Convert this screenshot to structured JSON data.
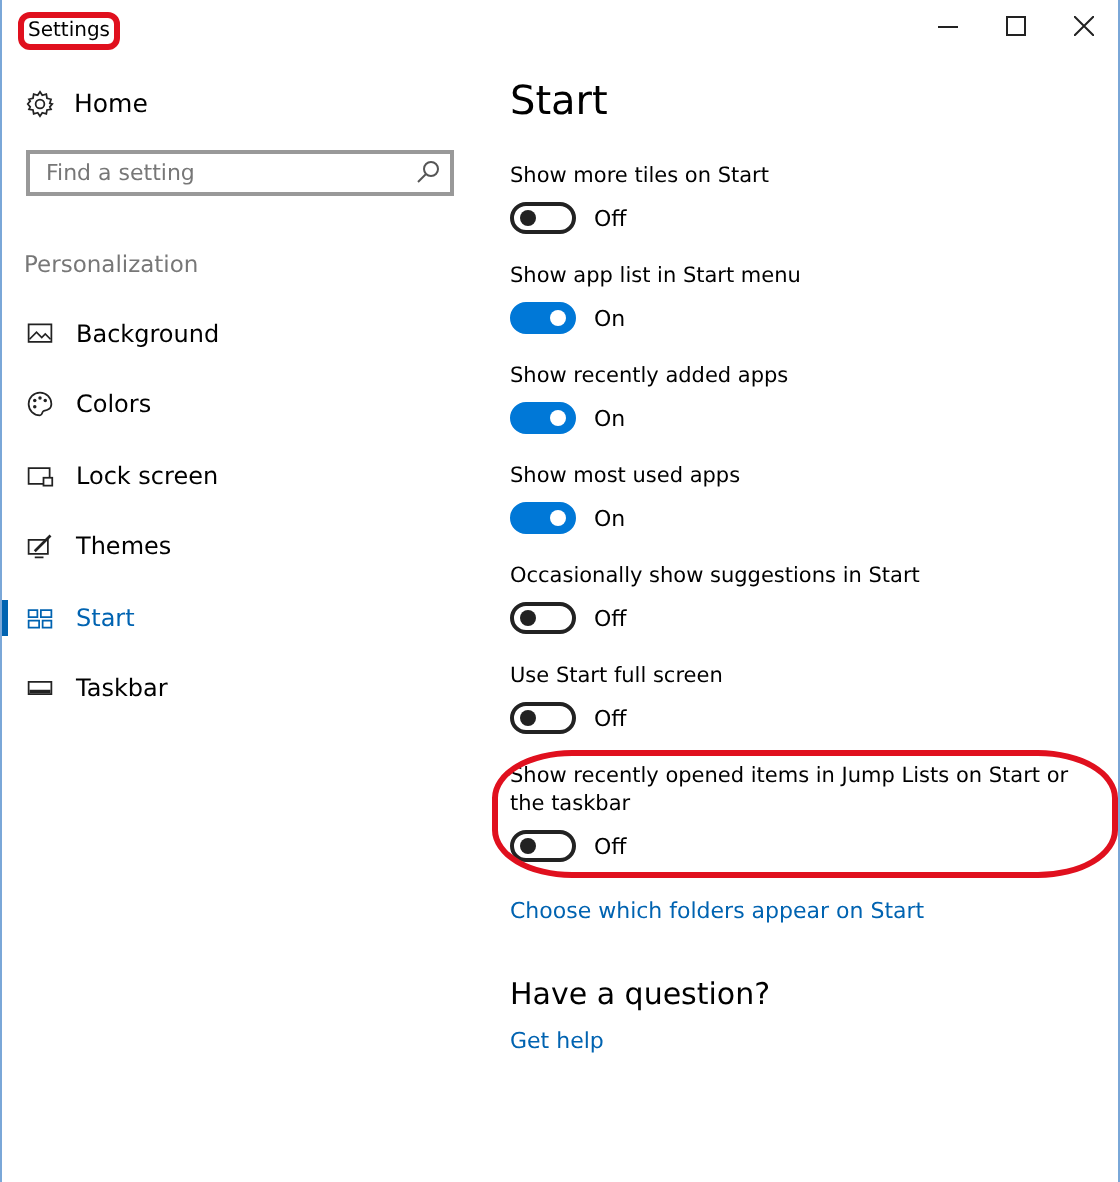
{
  "window": {
    "title": "Settings",
    "title_highlighted": true
  },
  "sidebar": {
    "home": "Home",
    "search": {
      "placeholder": "Find a setting"
    },
    "section": "Personalization",
    "items": [
      {
        "label": "Background",
        "selected": false
      },
      {
        "label": "Colors",
        "selected": false
      },
      {
        "label": "Lock screen",
        "selected": false
      },
      {
        "label": "Themes",
        "selected": false
      },
      {
        "label": "Start",
        "selected": true
      },
      {
        "label": "Taskbar",
        "selected": false
      }
    ]
  },
  "page": {
    "title": "Start",
    "settings": [
      {
        "label": "Show more tiles on Start",
        "on": false,
        "state": "Off",
        "highlighted": false
      },
      {
        "label": "Show app list in Start menu",
        "on": true,
        "state": "On",
        "highlighted": false
      },
      {
        "label": "Show recently added apps",
        "on": true,
        "state": "On",
        "highlighted": false
      },
      {
        "label": "Show most used apps",
        "on": true,
        "state": "On",
        "highlighted": false
      },
      {
        "label": "Occasionally show suggestions in Start",
        "on": false,
        "state": "Off",
        "highlighted": false
      },
      {
        "label": "Use Start full screen",
        "on": false,
        "state": "Off",
        "highlighted": false
      },
      {
        "label": "Show recently opened items in Jump Lists on Start or the taskbar",
        "on": false,
        "state": "Off",
        "highlighted": true
      }
    ],
    "link": "Choose which folders appear on Start",
    "question": {
      "title": "Have a question?",
      "link": "Get help"
    }
  }
}
